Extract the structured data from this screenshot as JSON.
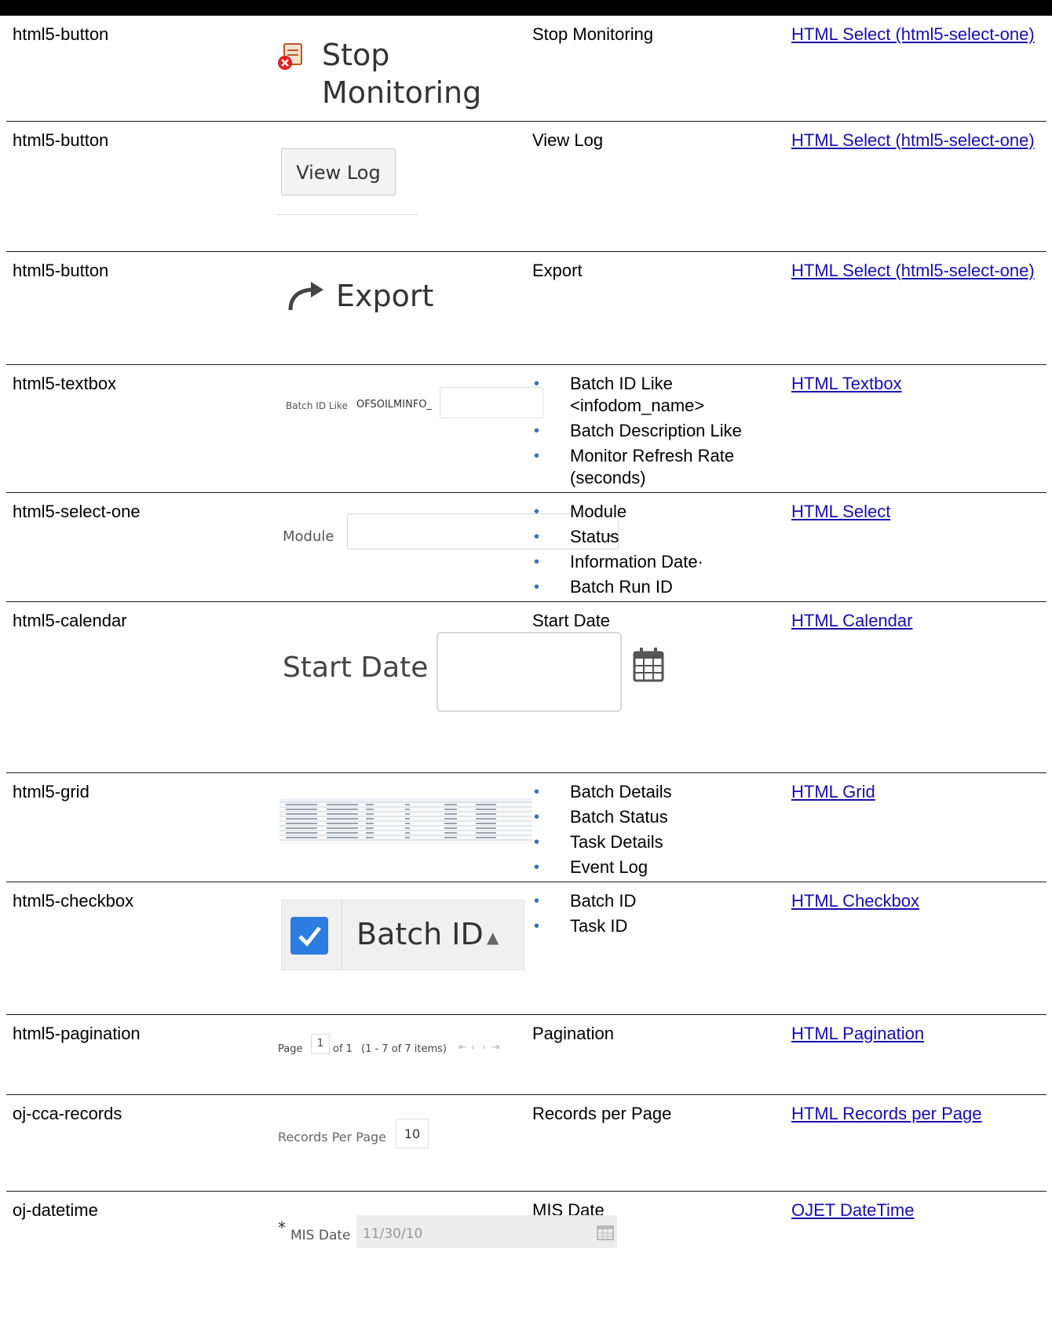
{
  "rows": [
    {
      "type": "html5-button",
      "desc": "Stop Monitoring",
      "link": "HTML Select (html5-select-one)",
      "preview_label": "Stop Monitoring"
    },
    {
      "type": "html5-button",
      "desc": "View Log",
      "link": "HTML Select (html5-select-one)",
      "preview_label": "View Log"
    },
    {
      "type": "html5-button",
      "desc": "Export",
      "link": "HTML Select (html5-select-one)",
      "preview_label": "Export"
    },
    {
      "type": "html5-textbox",
      "items": [
        "Batch ID Like <infodom_name>",
        "Batch Description Like",
        "Monitor Refresh Rate (seconds)"
      ],
      "link": "HTML Textbox",
      "preview_label": "Batch ID Like",
      "preview_value": "OFSOILMINFO_"
    },
    {
      "type": "html5-select-one",
      "items": [
        "Module",
        "Status",
        "Information Date·",
        "Batch Run ID"
      ],
      "link": "HTML Select",
      "preview_label": "Module"
    },
    {
      "type": "html5-calendar",
      "desc": "Start Date",
      "link": "HTML Calendar",
      "preview_label": "Start Date"
    },
    {
      "type": "html5-grid",
      "items": [
        "Batch Details",
        "Batch Status",
        "Task Details",
        "Event Log"
      ],
      "link": "HTML Grid"
    },
    {
      "type": "html5-checkbox",
      "items": [
        "Batch ID",
        "Task ID"
      ],
      "link": "HTML Checkbox",
      "preview_label": "Batch ID"
    },
    {
      "type": "html5-pagination",
      "desc": "Pagination",
      "link": "HTML Pagination",
      "preview": {
        "page": "Page",
        "page_no": "1",
        "of": "of 1",
        "range": "(1 - 7 of  7  items)"
      }
    },
    {
      "type": "oj-cca-records",
      "desc": "Records per Page",
      "link": "HTML Records per Page",
      "preview_label": "Records Per Page",
      "preview_value": "10"
    },
    {
      "type": "oj-datetime",
      "desc": "MIS Date",
      "link": "OJET DateTime",
      "preview_label": "MIS Date",
      "preview_value": "11/30/10"
    }
  ]
}
